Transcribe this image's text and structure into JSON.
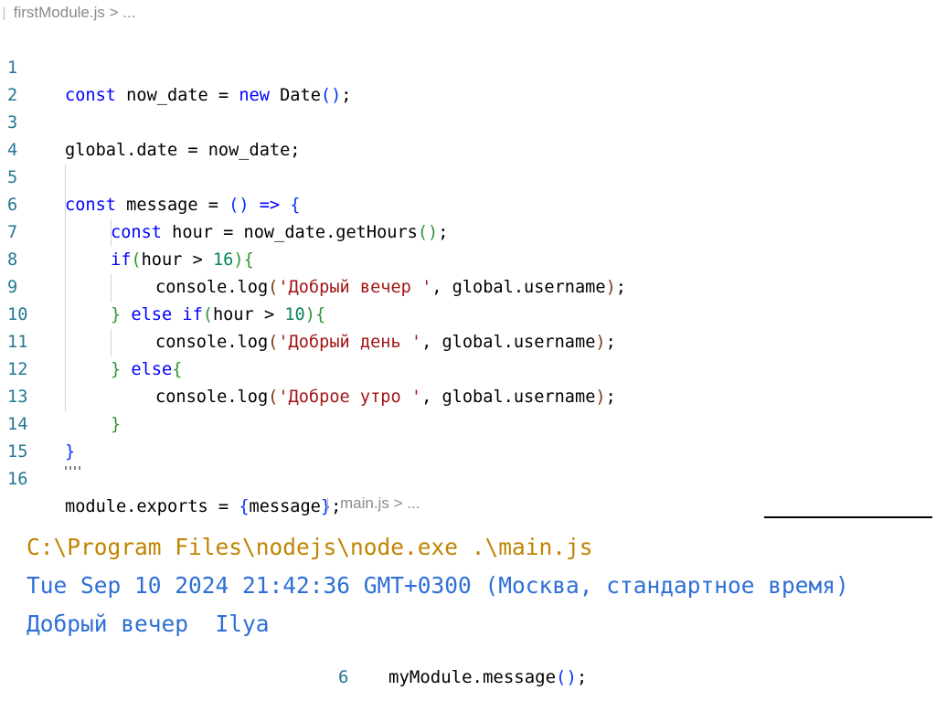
{
  "breadcrumb": {
    "file": "firstModule.js",
    "sep": ">",
    "more": "..."
  },
  "code_lines": [
    {
      "n": "1"
    },
    {
      "n": "2"
    },
    {
      "n": "3"
    },
    {
      "n": "4"
    },
    {
      "n": "5"
    },
    {
      "n": "6"
    },
    {
      "n": "7"
    },
    {
      "n": "8"
    },
    {
      "n": "9"
    },
    {
      "n": "10"
    },
    {
      "n": "11"
    },
    {
      "n": "12"
    },
    {
      "n": "13"
    },
    {
      "n": "14"
    },
    {
      "n": "15"
    },
    {
      "n": "16"
    }
  ],
  "code": {
    "l1": {
      "kw": "const",
      "rest": " now_date = ",
      "kw2": "new",
      "tail": " Date",
      "p1": "()",
      "semi": ";"
    },
    "l3": {
      "text": "global.date = now_date;"
    },
    "l5": {
      "kw": "const",
      "rest": " message = ",
      "p1": "()",
      "arrow": " => ",
      "brace": "{"
    },
    "l6": {
      "kw": "const",
      "rest": " hour = now_date.getHours",
      "p1": "()",
      "semi": ";"
    },
    "l7": {
      "kw": "if",
      "p_open": "(",
      "cond": "hour > ",
      "num": "16",
      "p_close": ")",
      "brace": "{"
    },
    "l8": {
      "pre": "console.log",
      "p_open": "(",
      "str": "'Добрый вечер '",
      "mid": ", global.username",
      "p_close": ")",
      "semi": ";"
    },
    "l9": {
      "brace_close": "}",
      "kw": " else if",
      "p_open": "(",
      "cond": "hour > ",
      "num": "10",
      "p_close": ")",
      "brace": "{"
    },
    "l10": {
      "pre": "console.log",
      "p_open": "(",
      "str": "'Добрый день '",
      "mid": ", global.username",
      "p_close": ")",
      "semi": ";"
    },
    "l11": {
      "brace_close": "}",
      "kw": " else",
      "brace": "{"
    },
    "l12": {
      "pre": "console.log",
      "p_open": "(",
      "str": "'Доброе утро '",
      "mid": ", global.username",
      "p_close": ")",
      "semi": ";"
    },
    "l13": {
      "brace_close": "}"
    },
    "l14": {
      "brace_close": "}"
    },
    "l16": {
      "pre": "module.exports = ",
      "brace_open": "{",
      "mid": "message",
      "brace_close": "}",
      "semi": ";"
    }
  },
  "breadcrumb2": {
    "file": "main.js",
    "sep": ">",
    "more": "..."
  },
  "terminal": {
    "command": "C:\\Program Files\\nodejs\\node.exe .\\main.js",
    "output1": "Tue Sep 10 2024 21:42:36 GMT+0300 (Москва, стандартное время)",
    "output2": "Добрый вечер  Ilya"
  },
  "bottom_snippet": {
    "line_number": "6",
    "pre": "myModule.message",
    "p": "()",
    "semi": ";"
  },
  "colors": {
    "keyword": "#0000ff",
    "number": "#098658",
    "string": "#a31515",
    "line_number": "#237893",
    "terminal_command": "#c18401",
    "terminal_output": "#2e6fd6"
  }
}
